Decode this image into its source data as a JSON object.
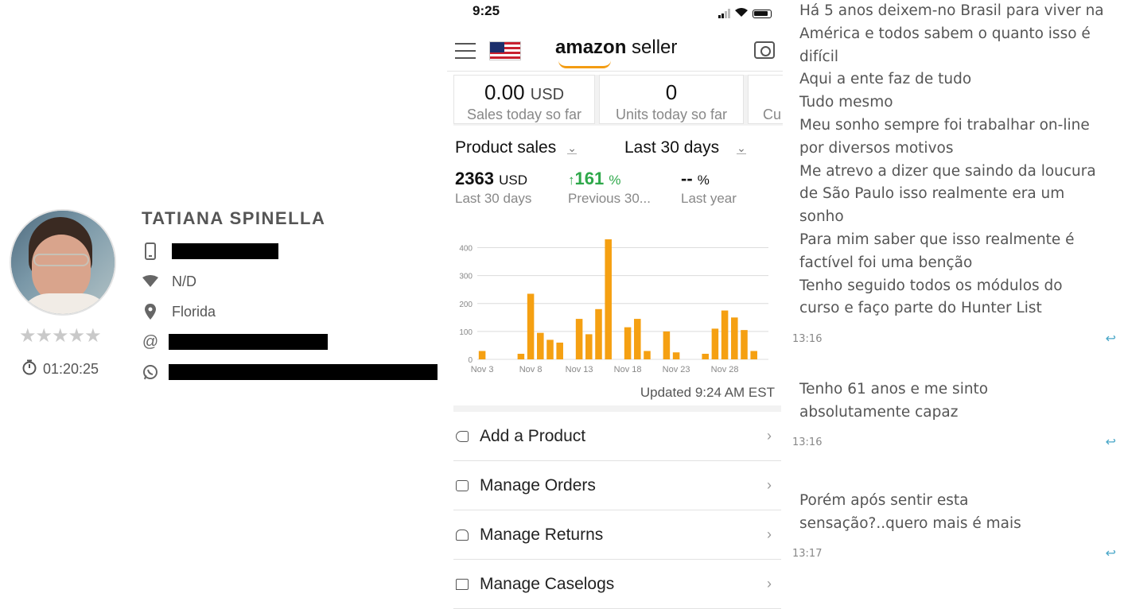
{
  "profile": {
    "name": "TATIANA SPINELLA",
    "network": "N/D",
    "location": "Florida",
    "email_prefix": "@",
    "rating_stars": "★★★★★",
    "rating_value": 0,
    "duration": "01:20:25",
    "icons": [
      "phone-icon",
      "wifi-icon",
      "location-pin-icon",
      "at-icon",
      "whatsapp-icon",
      "stopwatch-icon"
    ]
  },
  "phone": {
    "status_time": "9:25",
    "logo_brand": "amazon",
    "logo_suffix": " seller",
    "cards": [
      {
        "value": "0.00",
        "unit": "USD",
        "label": "Sales today so far"
      },
      {
        "value": "0",
        "unit": "",
        "label": "Units today so far"
      },
      {
        "value": "",
        "unit": "",
        "label": "Cu"
      }
    ],
    "metric_selector": "Product sales",
    "period_selector": "Last 30 days",
    "metrics": [
      {
        "value": "2363",
        "unit": "USD",
        "label": "Last 30 days"
      },
      {
        "value": "161",
        "unit": "%",
        "arrow": "↑",
        "label": "Previous 30..."
      },
      {
        "value": "--",
        "unit": "%",
        "label": "Last year"
      }
    ],
    "updated": "Updated 9:24 AM EST",
    "menu": [
      {
        "label": "Add a Product",
        "icon": "tag-icon"
      },
      {
        "label": "Manage Orders",
        "icon": "orders-icon"
      },
      {
        "label": "Manage Returns",
        "icon": "returns-icon"
      },
      {
        "label": "Manage Caselogs",
        "icon": "caselog-icon"
      }
    ]
  },
  "chart_data": {
    "type": "bar",
    "title": "",
    "xlabel": "",
    "ylabel": "",
    "ylim": [
      0,
      450
    ],
    "yticks": [
      0,
      100,
      200,
      300,
      400
    ],
    "xtick_labels": [
      "Nov 3",
      "Nov 8",
      "Nov 13",
      "Nov 18",
      "Nov 23",
      "Nov 28"
    ],
    "xtick_days": [
      3,
      8,
      13,
      18,
      23,
      28
    ],
    "color": "#f5a012",
    "grid": true,
    "days": [
      3,
      4,
      5,
      6,
      7,
      8,
      9,
      10,
      11,
      12,
      13,
      14,
      15,
      16,
      17,
      18,
      19,
      20,
      21,
      22,
      23,
      24,
      25,
      26,
      27,
      28,
      29,
      30,
      31,
      32
    ],
    "values": [
      30,
      0,
      0,
      0,
      20,
      235,
      95,
      70,
      60,
      0,
      145,
      90,
      180,
      430,
      0,
      115,
      145,
      30,
      0,
      100,
      25,
      0,
      0,
      20,
      110,
      175,
      150,
      105,
      30,
      0
    ]
  },
  "chat": {
    "messages": [
      {
        "lines": [
          "Há 5 anos deixem-no Brasil para viver na",
          "América e todos sabem o quanto isso é",
          "difícil",
          "Aqui a ente faz de tudo",
          "Tudo mesmo",
          "Meu sonho sempre foi trabalhar on-line",
          "por diversos motivos",
          "Me atrevo a dizer que saindo da loucura",
          "de São Paulo isso realmente era um",
          "sonho",
          "Para mim saber que isso realmente é",
          "factível foi uma benção",
          "Tenho seguido todos os módulos do",
          "curso e faço parte do Hunter List"
        ],
        "time": "13:16"
      },
      {
        "lines": [
          "Tenho 61 anos e me sinto",
          "absolutamente capaz"
        ],
        "time": "13:16"
      },
      {
        "lines": [
          "Porém após sentir esta",
          "sensação?..quero mais é mais"
        ],
        "time": "13:17"
      }
    ],
    "reply_icon": "↩"
  }
}
